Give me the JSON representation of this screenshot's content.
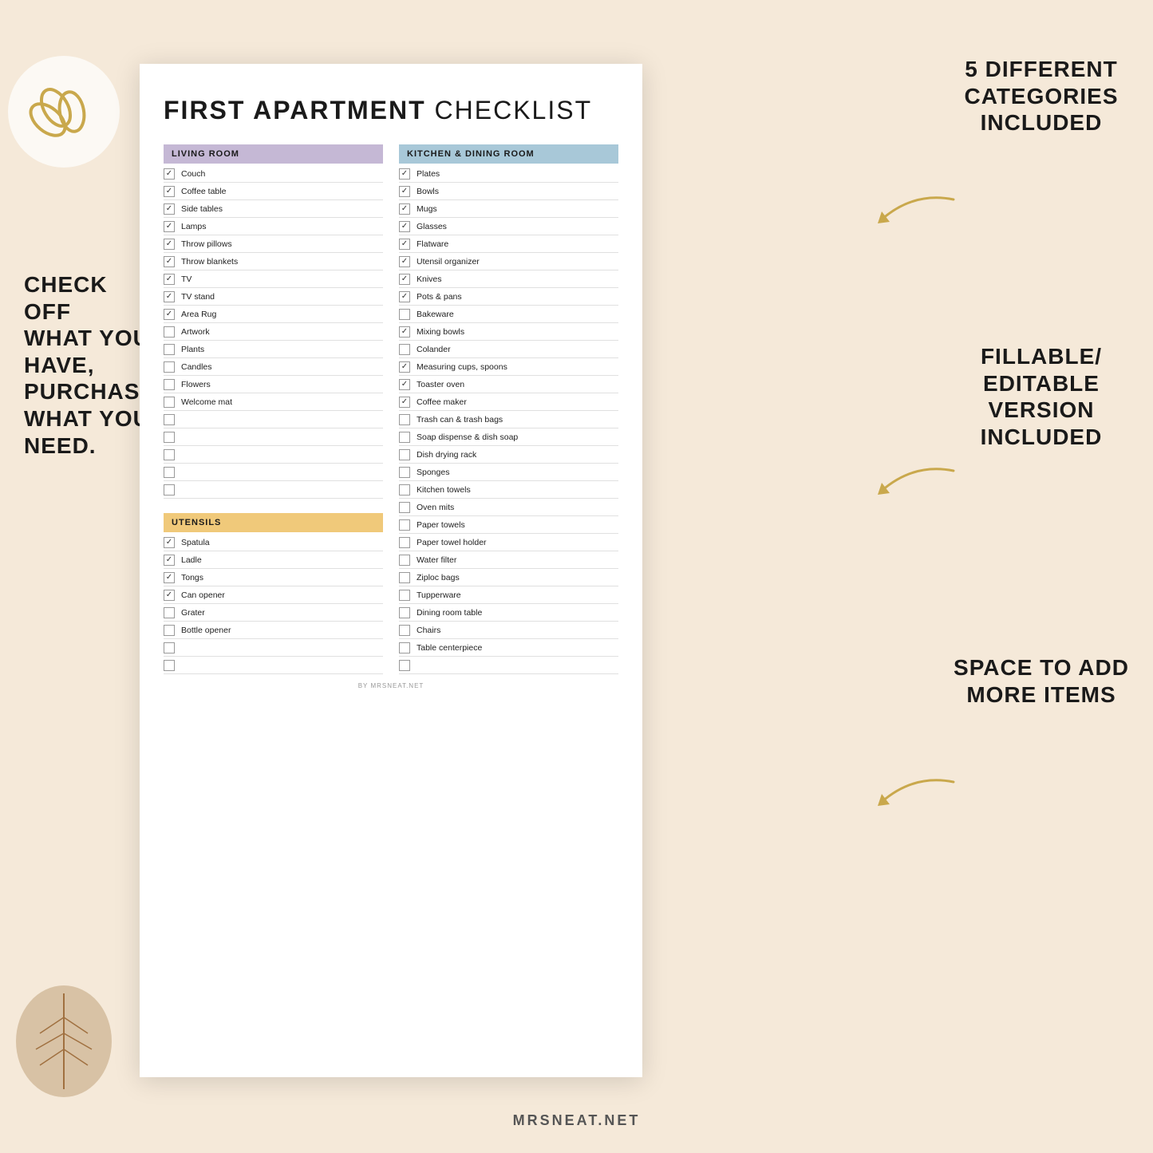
{
  "title": "FIRST APARTMENT CHECKLIST",
  "title_bold": "FIRST APARTMENT",
  "title_regular": "CHECKLIST",
  "footer_credit": "BY MRSNEAT.NET",
  "bottom_credit": "MRSNEAT.NET",
  "annotations": {
    "left": "CHECK OFF\nWHAT YOU\nHAVE,\nPURCHASE\nWHAT YOU\nNEED.",
    "right_top": "5 DIFFERENT\nCATEGORIES\nINCLUDED",
    "right_mid": "FILLABLE/\nEDITABLE\nVERSION\nINCLUDED",
    "right_bot": "SPACE TO ADD\nMORE ITEMS"
  },
  "categories": {
    "living_room": {
      "label": "LIVING ROOM",
      "items": [
        {
          "text": "Couch",
          "checked": true
        },
        {
          "text": "Coffee table",
          "checked": true
        },
        {
          "text": "Side tables",
          "checked": true
        },
        {
          "text": "Lamps",
          "checked": true
        },
        {
          "text": "Throw pillows",
          "checked": true
        },
        {
          "text": "Throw blankets",
          "checked": true
        },
        {
          "text": "TV",
          "checked": true
        },
        {
          "text": "TV stand",
          "checked": true
        },
        {
          "text": "Area Rug",
          "checked": true
        },
        {
          "text": "Artwork",
          "checked": false
        },
        {
          "text": "Plants",
          "checked": false
        },
        {
          "text": "Candles",
          "checked": false
        },
        {
          "text": "Flowers",
          "checked": false
        },
        {
          "text": "Welcome mat",
          "checked": false
        }
      ],
      "empty_slots": 5
    },
    "kitchen": {
      "label": "KITCHEN & DINING ROOM",
      "items": [
        {
          "text": "Plates",
          "checked": true
        },
        {
          "text": "Bowls",
          "checked": true
        },
        {
          "text": "Mugs",
          "checked": true
        },
        {
          "text": "Glasses",
          "checked": true
        },
        {
          "text": "Flatware",
          "checked": true
        },
        {
          "text": "Utensil organizer",
          "checked": true
        },
        {
          "text": "Knives",
          "checked": true
        },
        {
          "text": "Pots & pans",
          "checked": true
        },
        {
          "text": "Bakeware",
          "checked": false
        },
        {
          "text": "Mixing bowls",
          "checked": true
        },
        {
          "text": "Colander",
          "checked": false
        },
        {
          "text": "Measuring cups, spoons",
          "checked": true
        },
        {
          "text": "Toaster oven",
          "checked": true
        },
        {
          "text": "Coffee maker",
          "checked": true
        },
        {
          "text": "Trash can & trash bags",
          "checked": false
        },
        {
          "text": "Soap dispense & dish soap",
          "checked": false
        },
        {
          "text": "Dish drying rack",
          "checked": false
        },
        {
          "text": "Sponges",
          "checked": false
        },
        {
          "text": "Kitchen towels",
          "checked": false
        },
        {
          "text": "Oven mits",
          "checked": false
        },
        {
          "text": "Paper towels",
          "checked": false
        },
        {
          "text": "Paper towel holder",
          "checked": false
        },
        {
          "text": "Water filter",
          "checked": false
        },
        {
          "text": "Ziploc bags",
          "checked": false
        },
        {
          "text": "Tupperware",
          "checked": false
        },
        {
          "text": "Dining room table",
          "checked": false
        },
        {
          "text": "Chairs",
          "checked": false
        },
        {
          "text": "Table centerpiece",
          "checked": false
        }
      ],
      "empty_slots": 1
    },
    "utensils": {
      "label": "UTENSILS",
      "items": [
        {
          "text": "Spatula",
          "checked": true
        },
        {
          "text": "Ladle",
          "checked": true
        },
        {
          "text": "Tongs",
          "checked": true
        },
        {
          "text": "Can opener",
          "checked": true
        },
        {
          "text": "Grater",
          "checked": false
        },
        {
          "text": "Bottle opener",
          "checked": false
        }
      ],
      "empty_slots": 2
    }
  }
}
